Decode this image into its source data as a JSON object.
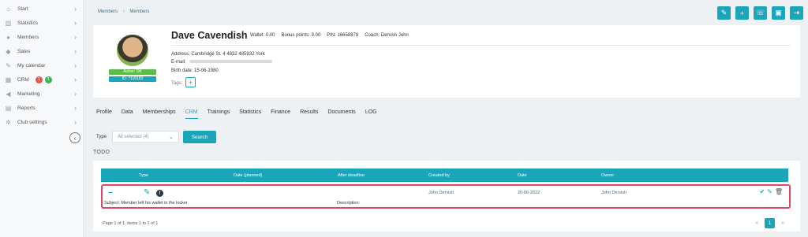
{
  "sidebar": {
    "items": [
      {
        "label": "Start",
        "icon": "home-icon"
      },
      {
        "label": "Statistics",
        "icon": "chart-icon"
      },
      {
        "label": "Members",
        "icon": "user-icon"
      },
      {
        "label": "Sales",
        "icon": "tag-icon"
      },
      {
        "label": "My calendar",
        "icon": "pencil-icon"
      },
      {
        "label": "CRM",
        "icon": "grid-icon",
        "badges": [
          "1",
          "1"
        ]
      },
      {
        "label": "Marketing",
        "icon": "megaphone-icon"
      },
      {
        "label": "Reports",
        "icon": "report-icon"
      },
      {
        "label": "Club settings",
        "icon": "gear-icon"
      }
    ]
  },
  "breadcrumb": {
    "item1": "Members",
    "item2": "Members"
  },
  "member": {
    "name": "Dave Cavendish",
    "wallet": "Wallet: 0.00",
    "bonus": "Bonus points: 9.00",
    "pin": "PIN: 16658878",
    "coach": "Coach: Dervish John",
    "address": "Address: Cambridge St. 4 4832 485932 York",
    "email_label": "E-mail:",
    "birth": "Birth date: 15-06-1980",
    "status": "Active: OK",
    "id": "ID: 7118183",
    "tags_label": "Tags:"
  },
  "tabs": [
    "Profile",
    "Data",
    "Memberships",
    "CRM",
    "Trainings",
    "Statistics",
    "Finance",
    "Results",
    "Documents",
    "LOG"
  ],
  "filter": {
    "type_label": "Type",
    "select_value": "All selected (4)",
    "search_label": "Search"
  },
  "todo": {
    "title": "TODO",
    "columns": {
      "type": "Type",
      "date_planned": "Date (planned)",
      "after_deadline": "After deadline",
      "created_by": "Created by",
      "date": "Date",
      "owner": "Owner"
    },
    "row": {
      "created_by": "John Dervish",
      "date": "20-06-2022",
      "owner": "John Dervish",
      "subject": "Subject: Member left his wallet in the locker",
      "description": "Description:"
    },
    "pager_text": "Page 1 of 1, items 1 to 1 of 1",
    "page": "1"
  },
  "colors": {
    "accent": "#1aa5b8",
    "highlight": "#e04668",
    "active": "#5cba47"
  }
}
